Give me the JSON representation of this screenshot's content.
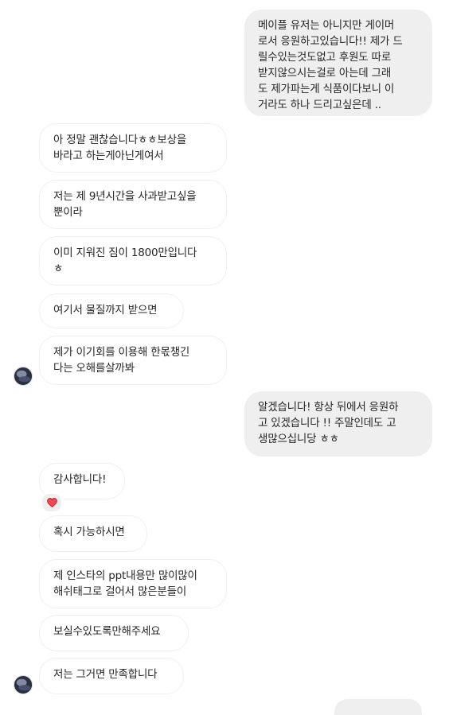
{
  "conversation": {
    "messages": [
      {
        "id": "m1",
        "side": "sent",
        "text": "메이플 유저는 아니지만 게이머\n로서 응원하고있습니다!! 제가 드\n릴수있는것도없고 후원도 따로\n받지않으시는걸로 아는데 그래\n도 제가파는게 식품이다보니 이\n거라도 하나 드리고싶은데 .."
      },
      {
        "id": "m2",
        "side": "received",
        "text": "아 정말 괜찮습니다ㅎㅎ보상을\n바라고 하는게아닌게여서"
      },
      {
        "id": "m3",
        "side": "received",
        "text": "저는 제 9년시간을 사과받고싶을\n뿐이라"
      },
      {
        "id": "m4",
        "side": "received",
        "text": "이미 지워진 짐이 1800만입니다\nㅎ"
      },
      {
        "id": "m5",
        "side": "received",
        "text": "여기서 물질까지 받으면"
      },
      {
        "id": "m6",
        "side": "received",
        "text": "제가 이기회를 이용해 한몫챙긴\n다는 오해를살까봐"
      },
      {
        "id": "m7",
        "side": "sent",
        "text": "알겠습니다! 항상 뒤에서 응원하\n고 있겠습니다 !! 주말인데도 고\n생많으십니당 ㅎㅎ"
      },
      {
        "id": "m8",
        "side": "received",
        "text": "감사합니다!",
        "reaction": "heart-icon"
      },
      {
        "id": "m9",
        "side": "received",
        "text": "혹시 가능하시면"
      },
      {
        "id": "m10",
        "side": "received",
        "text": "제 인스타의 ppt내용만 많이많이\n해쉬태그로 걸어서 많은분들이"
      },
      {
        "id": "m11",
        "side": "received",
        "text": "보실수있도록만해주세요"
      },
      {
        "id": "m12",
        "side": "received",
        "text": "저는 그거면 만족합니다"
      }
    ]
  },
  "colors": {
    "sent_bubble": "#efefef",
    "received_border": "#efefef",
    "text": "#262626",
    "heart": "#ed4956"
  }
}
